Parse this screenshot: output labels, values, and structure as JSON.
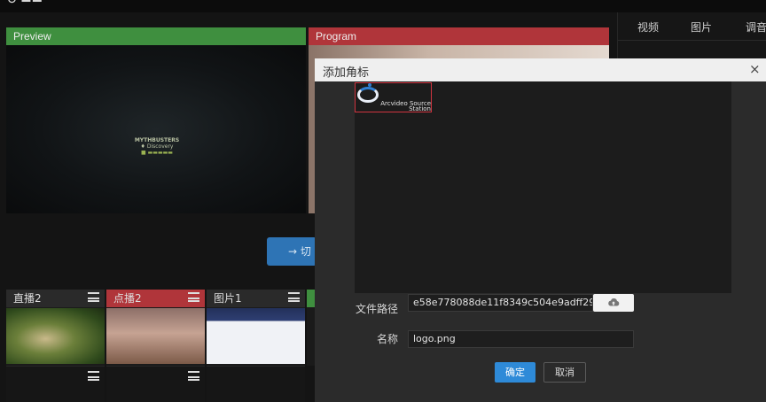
{
  "app": {
    "logo_text": "⊙ ▬▬"
  },
  "preview": {
    "header": "Preview",
    "screen_text": [
      "MYTHBUSTERS",
      "♦ Discovery",
      "■ ▬▬▬▬▬"
    ]
  },
  "program": {
    "header": "Program"
  },
  "switch_button": {
    "label": "→ 切"
  },
  "sources": [
    {
      "label": "直播2"
    },
    {
      "label": "点播2"
    },
    {
      "label": "图片1"
    },
    {
      "label": ""
    }
  ],
  "right_tabs": [
    "视频",
    "图片",
    "调音"
  ],
  "dialog": {
    "title": "添加角标",
    "close_icon": "×",
    "logo_preview_text": "Arcvideo Source Station",
    "file_path_label": "文件路径",
    "file_path_value": "e58e778088de11f8349c504e9adff29",
    "name_label": "名称",
    "name_value": "logo.png",
    "ok_label": "确定",
    "cancel_label": "取消"
  },
  "colors": {
    "preview_green": "#3f8f3f",
    "program_red": "#b0353a",
    "primary_blue": "#2e8ad8"
  }
}
